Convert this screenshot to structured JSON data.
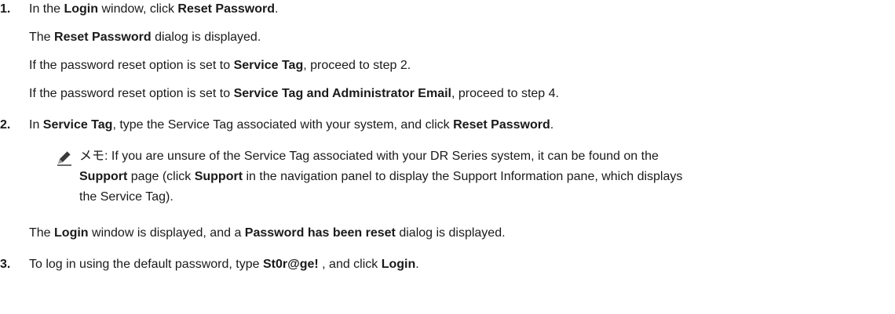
{
  "steps": [
    {
      "number": "1.",
      "main": {
        "t1": "In the ",
        "b1": "Login",
        "t2": " window, click ",
        "b2": "Reset Password",
        "t3": "."
      },
      "line2": {
        "t1": "The ",
        "b1": "Reset Password",
        "t2": " dialog is displayed."
      },
      "line3": {
        "t1": "If the password reset option is set to ",
        "b1": "Service Tag",
        "t2": ", proceed to step 2."
      },
      "line4": {
        "t1": "If the password reset option is set to ",
        "b1": "Service Tag and Administrator Email",
        "t2": ", proceed to step 4."
      }
    },
    {
      "number": "2.",
      "main": {
        "t1": "In ",
        "b1": "Service Tag",
        "t2": ", type the Service Tag associated with your system, and click ",
        "b2": "Reset Password",
        "t3": "."
      },
      "note": {
        "icon": "pencil-note-icon",
        "prefix": "メモ: ",
        "line1": "If you are unsure of the Service Tag associated with your DR Series system, it can be found on the",
        "line2": {
          "b1": "Support",
          "t1": " page (click ",
          "b2": "Support",
          "t2": " in the navigation panel to display the Support Information pane, which displays"
        },
        "line3": "the Service Tag)."
      },
      "result": {
        "t1": "The ",
        "b1": "Login",
        "t2": " window is displayed, and a ",
        "b2": "Password has been reset",
        "t3": " dialog is displayed."
      }
    },
    {
      "number": "3.",
      "main": {
        "t1": "To log in using the default password, type ",
        "b1": "St0r@ge!",
        "t2": " , and click ",
        "b2": "Login",
        "t3": "."
      }
    }
  ]
}
